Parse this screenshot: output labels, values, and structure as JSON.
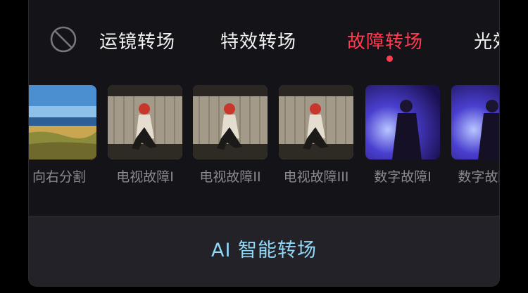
{
  "tabs": {
    "items": [
      {
        "label": "运镜转场"
      },
      {
        "label": "特效转场"
      },
      {
        "label": "故障转场"
      },
      {
        "label": "光效"
      }
    ],
    "active_index": 2
  },
  "effects": [
    {
      "label": "向右分割",
      "scene": "beach"
    },
    {
      "label": "电视故障I",
      "scene": "woman-fence"
    },
    {
      "label": "电视故障II",
      "scene": "woman-fence"
    },
    {
      "label": "电视故障III",
      "scene": "woman-fence"
    },
    {
      "label": "数字故障I",
      "scene": "stage-light"
    },
    {
      "label": "数字故障II",
      "scene": "stage-light"
    }
  ],
  "footer": {
    "ai_button_label": "AI 智能转场"
  },
  "colors": {
    "accent": "#ff3b52",
    "ai_text": "#8fd8f7",
    "panel_bg": "#141317"
  }
}
